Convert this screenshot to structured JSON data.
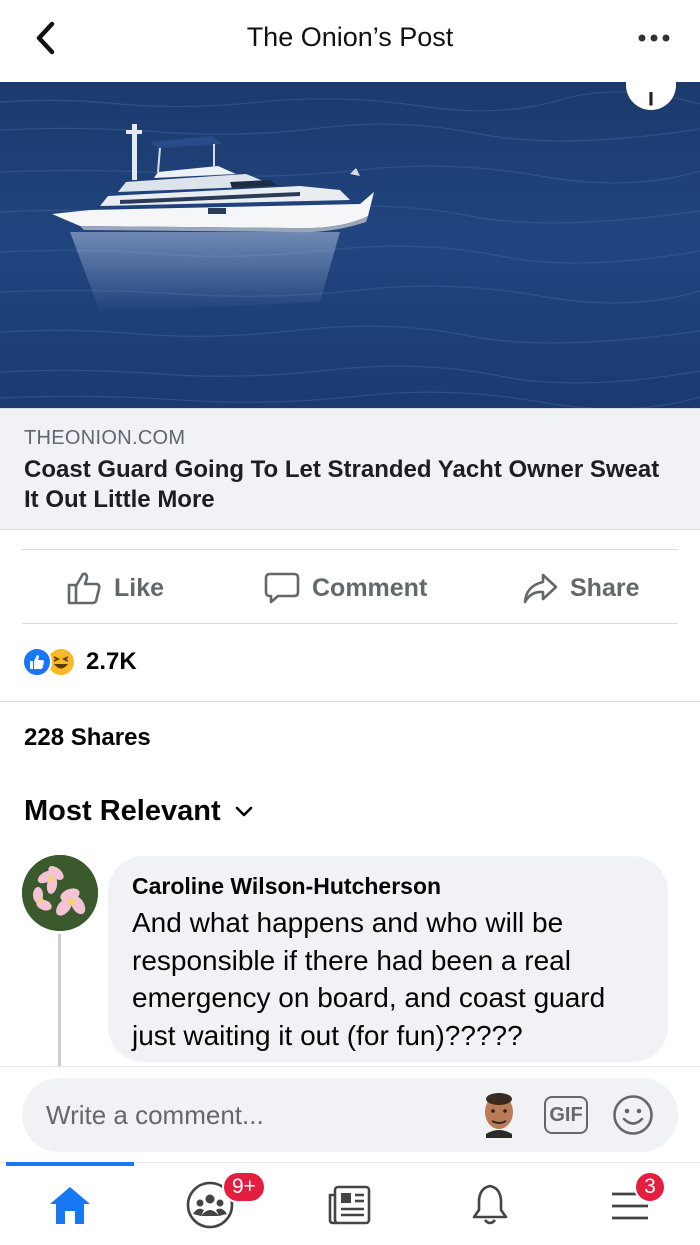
{
  "header": {
    "title": "The Onion’s Post"
  },
  "link_preview": {
    "domain": "THEONION.COM",
    "title": "Coast Guard Going To Let Stranded Yacht Owner Sweat It Out Little More"
  },
  "actions": {
    "like": "Like",
    "comment": "Comment",
    "share": "Share"
  },
  "reactions": {
    "count": "2.7K"
  },
  "shares": {
    "label": "228 Shares"
  },
  "comments": {
    "sort_label": "Most Relevant",
    "items": [
      {
        "author": "Caroline Wilson-Hutcherson",
        "text": "And what happens and who will be responsible if there had been a real emergency on board, and coast guard just waiting it out (for fun)?????"
      }
    ]
  },
  "composer": {
    "placeholder": "Write a comment...",
    "gif_label": "GIF"
  },
  "tabbar": {
    "groups_badge": "9+",
    "menu_badge": "3",
    "accent": "#1877f2",
    "badge_color": "#e41e3f"
  },
  "icons": [
    "back-arrow-icon",
    "more-dots-icon",
    "info-icon",
    "like-thumb-icon",
    "comment-bubble-icon",
    "share-arrow-icon",
    "chevron-down-icon",
    "gif-icon",
    "sticker-smiley-icon",
    "home-icon",
    "groups-icon",
    "news-feed-icon",
    "bell-icon",
    "menu-icon"
  ]
}
